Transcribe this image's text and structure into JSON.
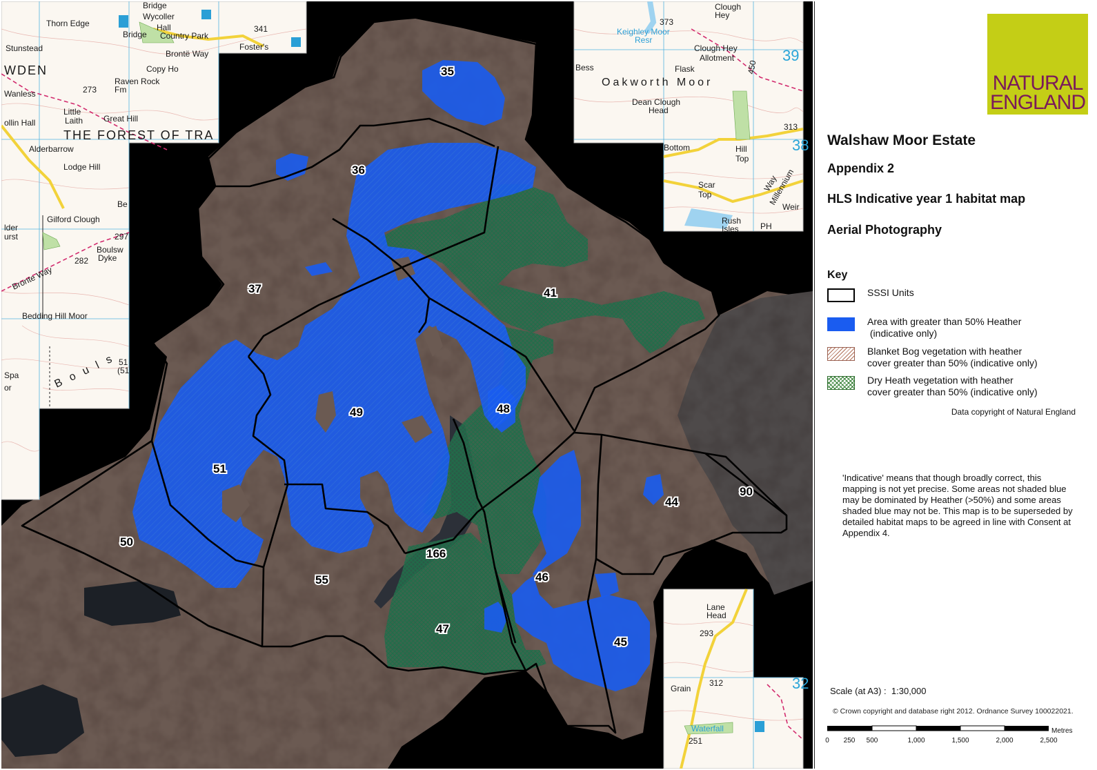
{
  "legend": {
    "title": "Walshaw Moor Estate",
    "subtitle1": "Appendix 2",
    "subtitle2": "HLS Indicative year 1 habitat map",
    "subtitle3": "Aerial Photography",
    "key_title": "Key",
    "items": [
      {
        "label": "SSSI Units"
      },
      {
        "label_line1": "Area with greater than 50% Heather",
        "label_line2": " (indicative only)"
      },
      {
        "label_line1": "Blanket Bog vegetation with heather",
        "label_line2": "cover greater than 50% (indicative only)"
      },
      {
        "label_line1": "Dry Heath vegetation with heather",
        "label_line2": "cover greater than 50% (indicative only)"
      }
    ],
    "data_copyright": "Data copyright of Natural England",
    "note": "'Indicative' means that though broadly correct, this mapping is not yet precise. Some areas not shaded blue may be dominated by Heather (>50%) and some areas shaded blue may not be. This map is to be superseded by detailed habitat maps to be agreed in line with Consent at Appendix 4.",
    "scale_label": "Scale (at A3) :",
    "scale_value": "1:30,000",
    "crown_copyright": "© Crown copyright and database right 2012. Ordnance Survey 100022021.",
    "scalebar_unit": "Metres",
    "scalebar_ticks": [
      "0",
      "250",
      "500",
      "1,000",
      "1,500",
      "2,000",
      "2,500"
    ]
  },
  "logo": {
    "line1": "NATURAL",
    "line2": "ENGLAND",
    "bg": "#c4ce16",
    "fg": "#7a1a5a"
  },
  "units": [
    "35",
    "36",
    "37",
    "41",
    "48",
    "49",
    "51",
    "50",
    "55",
    "166",
    "46",
    "47",
    "45",
    "44",
    "90"
  ],
  "os_labels": {
    "top_left": [
      "Bridge",
      "Wycoller",
      "Thorn Edge",
      "Hall",
      "Country Park",
      "Bridge",
      "341",
      "Stunstead",
      "Foster's",
      "Brontë Way",
      "WDEN",
      "Copy Ho",
      "Wanless",
      "273",
      "Raven Rock",
      "Fm",
      "Little",
      "Laith",
      "Great Hill",
      "ollin Hall",
      "THE FOREST OF TRA",
      "Alderbarrow",
      "Lodge Hill",
      "Be",
      "Gilford Clough",
      "lder",
      "urst",
      "297",
      "Boulsw",
      "Dyke",
      "282",
      "Bronte Way",
      "Bedding Hill Moor",
      "B o u l s",
      "51",
      "(51",
      "Spa",
      "or"
    ],
    "top_right": [
      "Clough",
      "Hey",
      "373",
      "Keighley Moor",
      "Resr",
      "Clough Hey",
      "Allotment",
      "Bess",
      "Flask",
      "39",
      "Oakworth Moor",
      "450",
      "Dean Clough",
      "Head",
      "313",
      "Bottom",
      "Hill",
      "Top",
      "Scar",
      "Top",
      "Millennium",
      "Way",
      "Weir",
      "Rush",
      "Isles",
      "PH",
      "38"
    ],
    "bottom_right": [
      "Lane",
      "Head",
      "293",
      "Grain",
      "312",
      "Waterfall",
      "251",
      "32"
    ]
  }
}
